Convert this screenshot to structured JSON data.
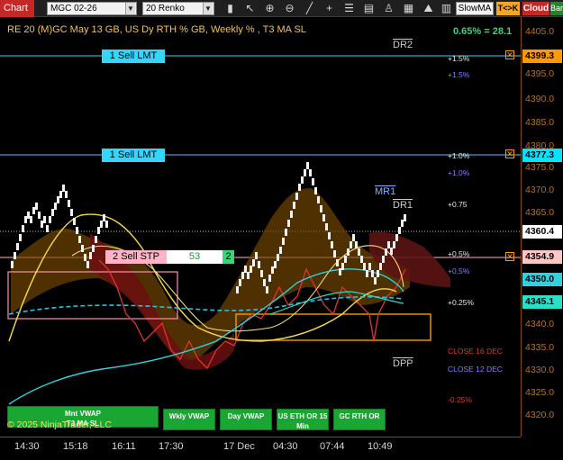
{
  "toolbar": {
    "tab_label": "Chart",
    "instrument": "MGC 02-26",
    "bar_type": "20 Renko",
    "slow_ma": "SlowMA",
    "tcb": "T<>K",
    "cloud": "Cloud",
    "bar": "Bar",
    "icons": [
      "bars-icon",
      "pointer-icon",
      "zoom-in-icon",
      "zoom-out-icon",
      "crosshair-icon",
      "line-tool-icon",
      "properties-icon",
      "indicators-icon",
      "strategy-icon",
      "template-icon",
      "mountain-icon"
    ]
  },
  "chart": {
    "title": "RE 20  (M)GC May 13 GB, US Dy RTH % GB, Weekly % , T3 MA SL",
    "pct_readout": "0.65% = 28.1",
    "copyright": "© 2025 NinjaTrader, LLC",
    "price_axis": [
      "4405.0",
      "4395.0",
      "4390.0",
      "4385.0",
      "4380.0",
      "4375.0",
      "4370.0",
      "4365.0",
      "4355.0",
      "4340.0",
      "4335.0",
      "4330.0",
      "4325.0",
      "4320.0"
    ],
    "price_boxes": [
      {
        "value": "4399.3",
        "bg": "#ff9900",
        "fg": "#000"
      },
      {
        "value": "4377.3",
        "bg": "#00e5ff",
        "fg": "#000"
      },
      {
        "value": "4360.4",
        "bg": "#ffffff",
        "fg": "#000"
      },
      {
        "value": "4354.9",
        "bg": "#ffc6c6",
        "fg": "#000"
      },
      {
        "value": "4350.0",
        "bg": "#2fd3e0",
        "fg": "#000"
      },
      {
        "value": "4345.1",
        "bg": "#29e0c8",
        "fg": "#000"
      }
    ],
    "time_axis": [
      "14:30",
      "15:18",
      "16:11",
      "17:30",
      "17 Dec",
      "04:30",
      "07:44",
      "10:49"
    ],
    "orders": {
      "sell_lmt_1": "1 Sell LMT",
      "sell_lmt_2": "1 Sell LMT",
      "sell_stp": "2 Sell STP",
      "stp_ticks": "53",
      "stp_qty": "2"
    },
    "levels": {
      "dr2": "DR2",
      "mr1": "MR1",
      "dr1": "DR1",
      "dpp": "DPP",
      "p15a": "+1.5%",
      "p15b": "+1.5%",
      "p10a": "+1.0%",
      "p10b": "+1,0%",
      "p075": "+0.75",
      "p05a": "+0.5%",
      "p05b": "+0,5%",
      "p025": "+0.25%",
      "m025": "-0.25%",
      "close16": "CLOSE 16 DEC",
      "close12": "CLOSE 12 DEC"
    },
    "vwap_buttons": {
      "mnt": "Mnt VWAP",
      "t3": "T3 MA SL",
      "wkly": "Wkly VWAP",
      "day": "Day VWAP",
      "us_eth": "US ETH OR 15 Min",
      "gc_rth": "GC RTH OR"
    },
    "colors": {
      "sell_lmt": "#33d6ff",
      "sell_stp": "#ffb3c6",
      "green_up": "#37d67a",
      "orange": "#ff9900",
      "red": "#e03232"
    }
  }
}
